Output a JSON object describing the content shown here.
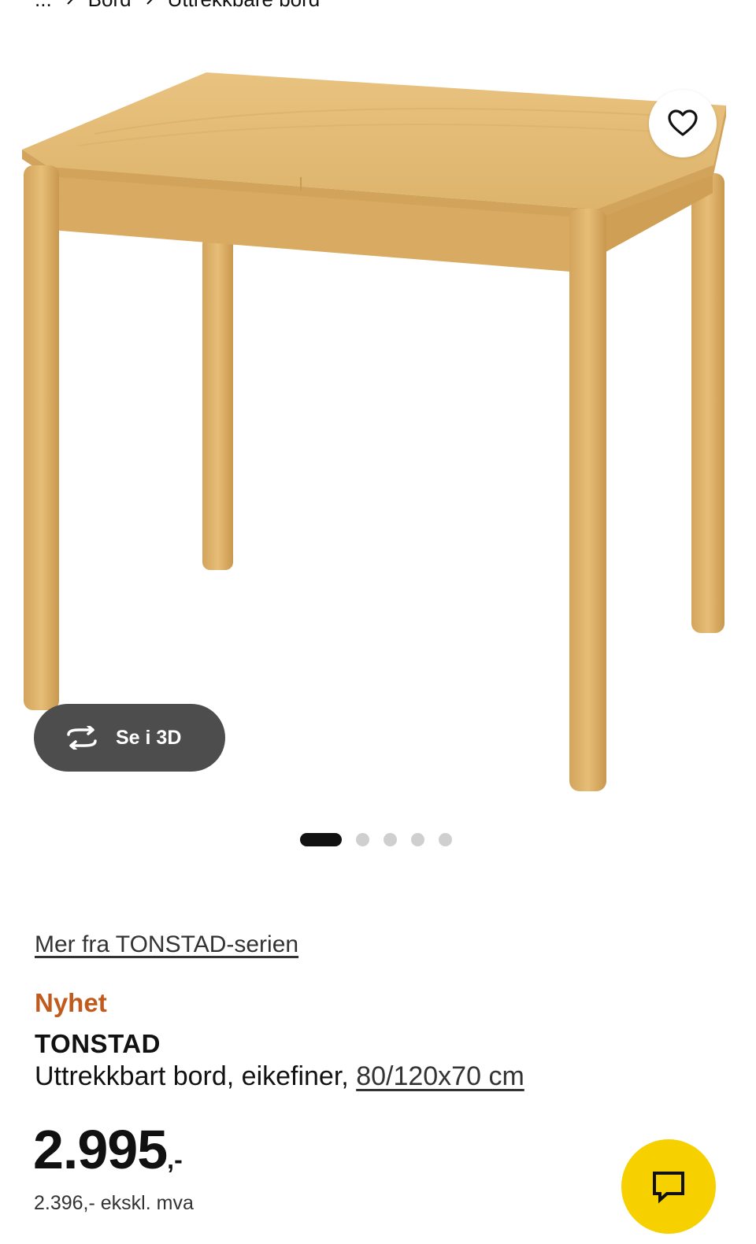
{
  "breadcrumb": {
    "items": [
      "...",
      "Bord",
      "Uttrekkbare bord"
    ]
  },
  "image_carousel": {
    "total_images": 5,
    "active_index": 0
  },
  "view_3d": {
    "label": "Se i 3D",
    "icon": "rotate-3d-icon"
  },
  "favorite": {
    "icon": "heart-outline-icon"
  },
  "product": {
    "series_link": "Mer fra TONSTAD-serien",
    "badge": "Nyhet",
    "name": "TONSTAD",
    "description": "Uttrekkbart bord, eikefiner, ",
    "dimensions": "80/120x70 cm",
    "price_main": "2.995",
    "price_suffix": ",-",
    "price_ex_vat": "2.396,- ekskl. mva"
  },
  "chat": {
    "icon": "chat-bubble-icon"
  },
  "colors": {
    "badge_new": "#c05b1d",
    "chat_button": "#f7d000",
    "view3d_button": "#4d4d4d",
    "wood": "#e0b46a"
  }
}
